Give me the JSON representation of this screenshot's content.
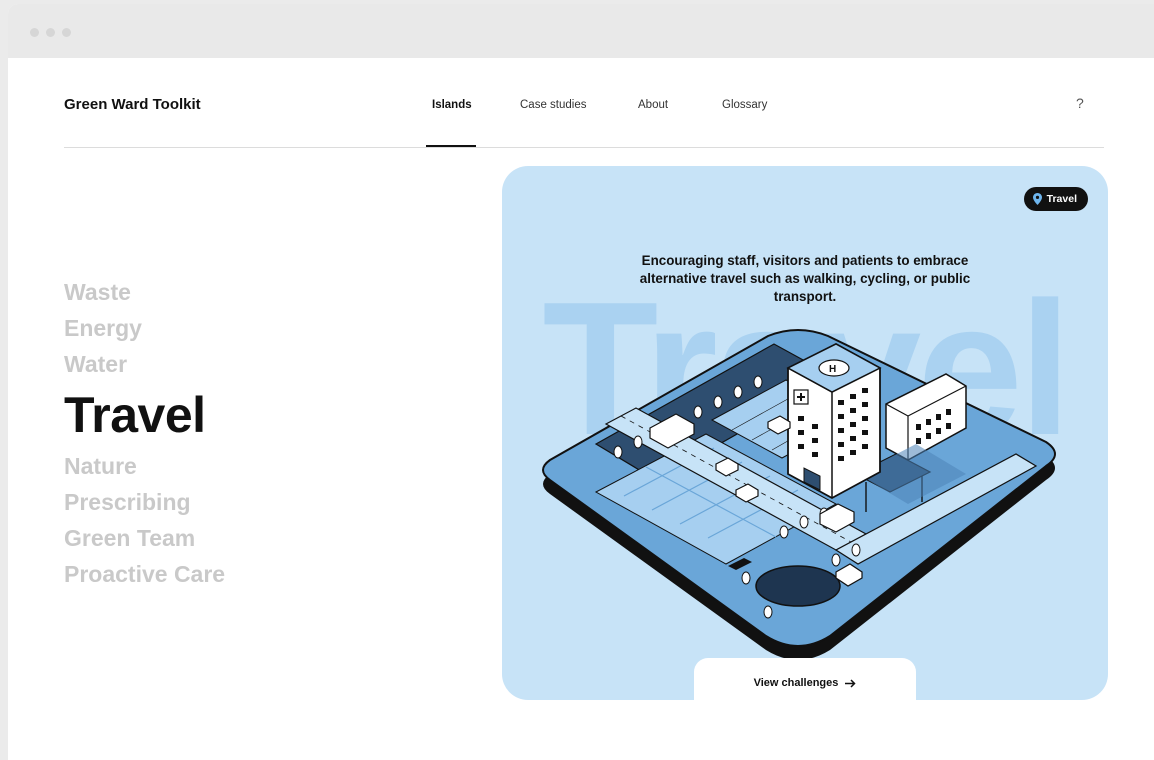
{
  "site": {
    "title": "Green Ward Toolkit",
    "help": "?"
  },
  "nav": [
    {
      "label": "Islands",
      "active": true
    },
    {
      "label": "Case studies",
      "active": false
    },
    {
      "label": "About",
      "active": false
    },
    {
      "label": "Glossary",
      "active": false
    }
  ],
  "islands": [
    "Waste",
    "Energy",
    "Water",
    "Travel",
    "Nature",
    "Prescribing",
    "Green Team",
    "Proactive Care"
  ],
  "active_island": "Travel",
  "card": {
    "badge": "Travel",
    "badge_icon": "location-pin-icon",
    "background_word": "Travel",
    "description": "Encouraging staff, visitors and patients to embrace alternative travel such as walking, cycling, or public transport.",
    "cta_label": "View challenges",
    "cta_icon": "arrow-right-icon"
  },
  "colors": {
    "card_bg": "#c7e3f7",
    "bg_word": "#aad2f1",
    "island_inactive": "#c9c9c9",
    "island_active": "#111111",
    "illus_light": "#a6cff0",
    "illus_mid": "#6aa6d8",
    "illus_dark": "#2e4e70",
    "outline": "#111111"
  }
}
